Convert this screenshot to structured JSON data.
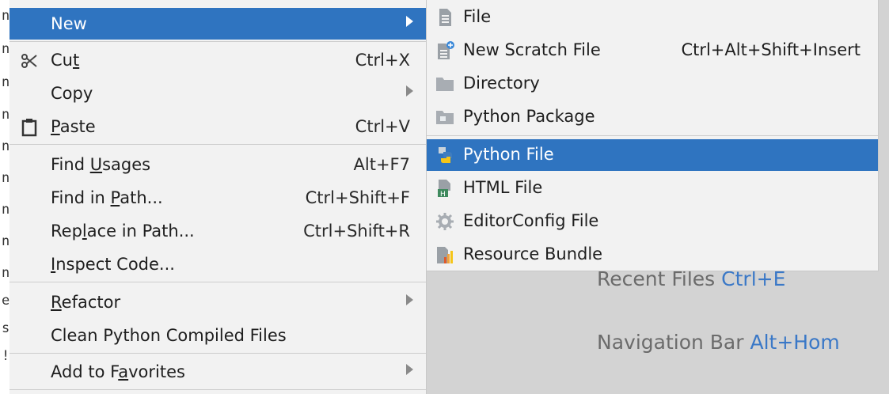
{
  "gutter": [
    "n",
    "n",
    "n",
    "n",
    "n",
    "n",
    "n",
    "n",
    "n",
    "e",
    "s",
    "!"
  ],
  "context_menu": {
    "items": [
      {
        "id": "new",
        "label": "New",
        "mnemonic": "",
        "shortcut": "",
        "submenu": true,
        "selected": true,
        "icon": ""
      },
      {
        "id": "cut",
        "label_pre": "Cu",
        "mnemonic": "t",
        "label_post": "",
        "shortcut": "Ctrl+X",
        "icon": "scissors-icon"
      },
      {
        "id": "copy",
        "label_pre": "Copy",
        "mnemonic": "",
        "label_post": "",
        "shortcut": "",
        "submenu": true
      },
      {
        "id": "paste",
        "label_pre": "",
        "mnemonic": "P",
        "label_post": "aste",
        "shortcut": "Ctrl+V",
        "icon": "clipboard-icon"
      },
      {
        "id": "find-usages",
        "label_pre": "Find ",
        "mnemonic": "U",
        "label_post": "sages",
        "shortcut": "Alt+F7"
      },
      {
        "id": "find-in-path",
        "label_pre": "Find in ",
        "mnemonic": "P",
        "label_post": "ath...",
        "shortcut": "Ctrl+Shift+F"
      },
      {
        "id": "replace-in-path",
        "label_pre": "Rep",
        "mnemonic": "l",
        "label_post": "ace in Path...",
        "shortcut": "Ctrl+Shift+R"
      },
      {
        "id": "inspect-code",
        "label_pre": "",
        "mnemonic": "I",
        "label_post": "nspect Code...",
        "shortcut": ""
      },
      {
        "id": "refactor",
        "label_pre": "",
        "mnemonic": "R",
        "label_post": "efactor",
        "shortcut": "",
        "submenu": true
      },
      {
        "id": "clean-python",
        "label_pre": "Clean Python Compiled Files",
        "mnemonic": "",
        "label_post": "",
        "shortcut": ""
      },
      {
        "id": "add-favorites",
        "label_pre": "Add to F",
        "mnemonic": "a",
        "label_post": "vorites",
        "shortcut": "",
        "submenu": true
      }
    ]
  },
  "submenu": {
    "items": [
      {
        "id": "file",
        "label": "File",
        "shortcut": "",
        "icon": "file-icon"
      },
      {
        "id": "scratch",
        "label": "New Scratch File",
        "shortcut": "Ctrl+Alt+Shift+Insert",
        "icon": "scratch-file-icon"
      },
      {
        "id": "directory",
        "label": "Directory",
        "shortcut": "",
        "icon": "folder-icon"
      },
      {
        "id": "python-package",
        "label": "Python Package",
        "shortcut": "",
        "icon": "package-folder-icon"
      },
      {
        "id": "python-file",
        "label": "Python File",
        "shortcut": "",
        "icon": "python-icon",
        "selected": true
      },
      {
        "id": "html-file",
        "label": "HTML File",
        "shortcut": "",
        "icon": "html-file-icon"
      },
      {
        "id": "editorconfig",
        "label": "EditorConfig File",
        "shortcut": "",
        "icon": "gear-icon"
      },
      {
        "id": "resource-bundle",
        "label": "Resource Bundle",
        "shortcut": "",
        "icon": "resource-bundle-icon"
      }
    ]
  },
  "hints": {
    "recent_label": "Recent Files ",
    "recent_key": "Ctrl+E",
    "nav_label": "Navigation Bar ",
    "nav_key": "Alt+Hom"
  },
  "colors": {
    "selection": "#2f74c0",
    "menu_bg": "#f2f2f2",
    "editor_bg": "#d3d3d3",
    "hint_key": "#3a78c7"
  }
}
